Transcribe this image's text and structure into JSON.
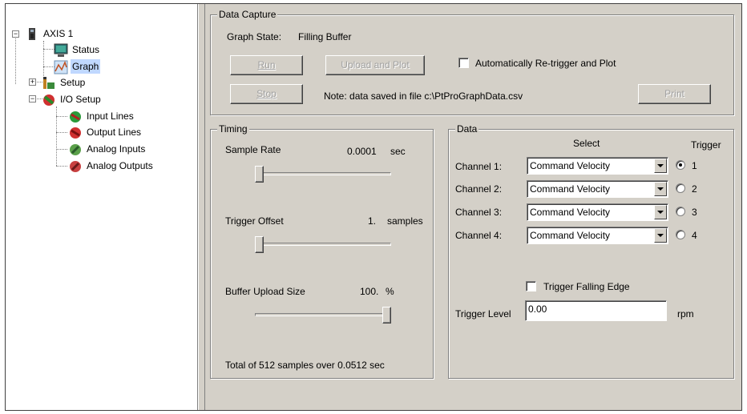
{
  "tree": {
    "root_label": "AXIS 1",
    "items": [
      {
        "label": "Status"
      },
      {
        "label": "Graph"
      },
      {
        "label": "Setup"
      },
      {
        "label": "I/O Setup"
      },
      {
        "label": "Input Lines"
      },
      {
        "label": "Output Lines"
      },
      {
        "label": "Analog Inputs"
      },
      {
        "label": "Analog Outputs"
      }
    ],
    "selected": "Graph"
  },
  "capture": {
    "title": "Data Capture",
    "state_label": "Graph State:",
    "state_value": "Filling Buffer",
    "run_label": "Run",
    "upload_label": "Upload and Plot",
    "stop_label": "Stop",
    "print_label": "Print",
    "retrigger_label": "Automatically Re-trigger and Plot",
    "retrigger_checked": false,
    "note": "Note: data saved in file c:\\PtProGraphData.csv"
  },
  "timing": {
    "title": "Timing",
    "sample_rate_label": "Sample Rate",
    "sample_rate_value": "0.0001",
    "sample_rate_unit": "sec",
    "sample_rate_level": 0.0,
    "trigger_offset_label": "Trigger Offset",
    "trigger_offset_value": "1.",
    "trigger_offset_unit": "samples",
    "trigger_offset_level": 0.0,
    "buffer_label": "Buffer Upload Size",
    "buffer_value": "100.",
    "buffer_unit": "%",
    "buffer_level": 1.0,
    "total_text": "Total of 512 samples over 0.0512 sec"
  },
  "data": {
    "title": "Data",
    "select_header": "Select",
    "trigger_header": "Trigger",
    "channels": [
      {
        "label": "Channel 1:",
        "value": "Command Velocity",
        "radio": "1",
        "selected": true
      },
      {
        "label": "Channel 2:",
        "value": "Command Velocity",
        "radio": "2",
        "selected": false
      },
      {
        "label": "Channel 3:",
        "value": "Command Velocity",
        "radio": "3",
        "selected": false
      },
      {
        "label": "Channel 4:",
        "value": "Command Velocity",
        "radio": "4",
        "selected": false
      }
    ],
    "falling_edge_label": "Trigger Falling Edge",
    "falling_edge_checked": false,
    "trigger_level_label": "Trigger Level",
    "trigger_level_value": "0.00",
    "trigger_level_unit": "rpm"
  },
  "icons": {
    "axis": "drive-icon",
    "status": "monitor-icon",
    "graph": "graph-icon",
    "setup": "setup-icon",
    "io": "io-icon"
  }
}
